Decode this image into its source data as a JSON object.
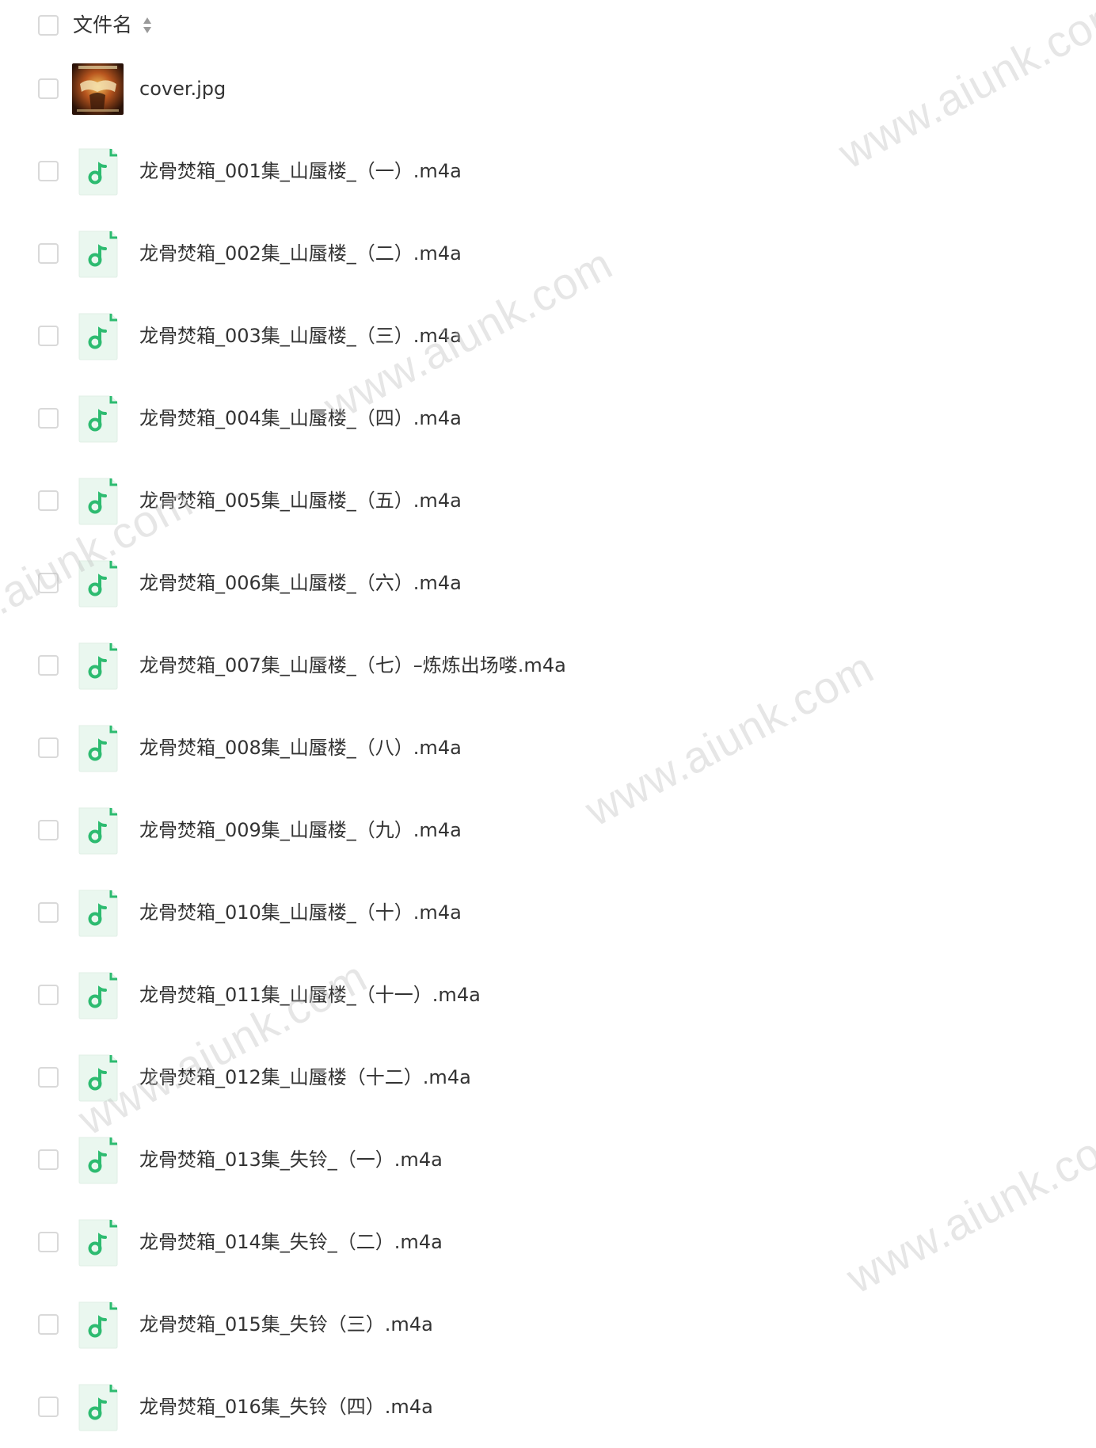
{
  "header": {
    "column_label": "文件名",
    "sort_icon": "sort-both-icon"
  },
  "colors": {
    "accent_green": "#2dbb70",
    "icon_bg": "#eaf7ef",
    "checkbox_border": "#d9d9d9"
  },
  "files": [
    {
      "name": "cover.jpg",
      "type": "image",
      "icon": "image-thumbnail"
    },
    {
      "name": "龙骨焚箱_001集_山蜃楼_（一）.m4a",
      "type": "audio",
      "icon": "music-note-icon"
    },
    {
      "name": "龙骨焚箱_002集_山蜃楼_（二）.m4a",
      "type": "audio",
      "icon": "music-note-icon"
    },
    {
      "name": "龙骨焚箱_003集_山蜃楼_（三）.m4a",
      "type": "audio",
      "icon": "music-note-icon"
    },
    {
      "name": "龙骨焚箱_004集_山蜃楼_（四）.m4a",
      "type": "audio",
      "icon": "music-note-icon"
    },
    {
      "name": "龙骨焚箱_005集_山蜃楼_（五）.m4a",
      "type": "audio",
      "icon": "music-note-icon"
    },
    {
      "name": "龙骨焚箱_006集_山蜃楼_（六）.m4a",
      "type": "audio",
      "icon": "music-note-icon"
    },
    {
      "name": "龙骨焚箱_007集_山蜃楼_（七）–炼炼出场喽.m4a",
      "type": "audio",
      "icon": "music-note-icon"
    },
    {
      "name": "龙骨焚箱_008集_山蜃楼_（八）.m4a",
      "type": "audio",
      "icon": "music-note-icon"
    },
    {
      "name": "龙骨焚箱_009集_山蜃楼_（九）.m4a",
      "type": "audio",
      "icon": "music-note-icon"
    },
    {
      "name": "龙骨焚箱_010集_山蜃楼_（十）.m4a",
      "type": "audio",
      "icon": "music-note-icon"
    },
    {
      "name": "龙骨焚箱_011集_山蜃楼_（十一）.m4a",
      "type": "audio",
      "icon": "music-note-icon"
    },
    {
      "name": "龙骨焚箱_012集_山蜃楼（十二）.m4a",
      "type": "audio",
      "icon": "music-note-icon"
    },
    {
      "name": "龙骨焚箱_013集_失铃_（一）.m4a",
      "type": "audio",
      "icon": "music-note-icon"
    },
    {
      "name": "龙骨焚箱_014集_失铃_（二）.m4a",
      "type": "audio",
      "icon": "music-note-icon"
    },
    {
      "name": "龙骨焚箱_015集_失铃（三）.m4a",
      "type": "audio",
      "icon": "music-note-icon"
    },
    {
      "name": "龙骨焚箱_016集_失铃（四）.m4a",
      "type": "audio",
      "icon": "music-note-icon"
    }
  ],
  "watermark_text": "www.aiunk.com"
}
